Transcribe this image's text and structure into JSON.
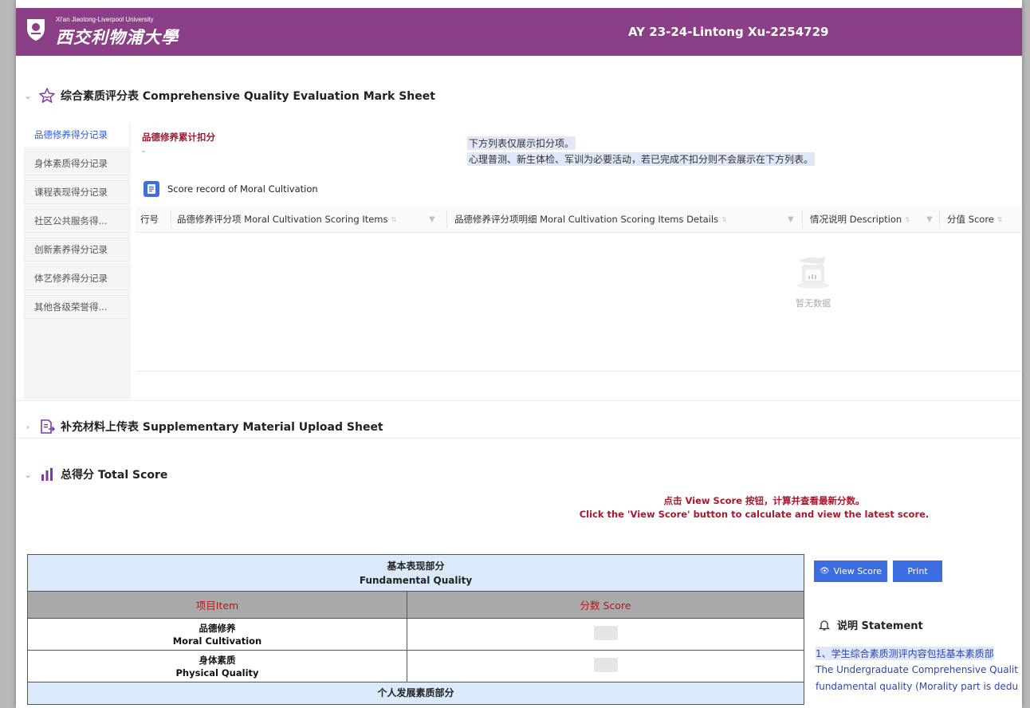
{
  "header": {
    "logo_en": "Xi'an Jiaotong-Liverpool University",
    "logo_cn": "西交利物浦大學",
    "title": "AY 23-24-Lintong Xu-2254729"
  },
  "sections": {
    "evaluation": {
      "title": "综合素质评分表 Comprehensive Quality Evaluation Mark Sheet",
      "expanded": true
    },
    "supplementary": {
      "title": "补充材料上传表 Supplementary Material Upload Sheet",
      "expanded": false
    },
    "total": {
      "title": "总得分 Total Score",
      "expanded": true
    }
  },
  "menu": {
    "items": [
      {
        "label": "品德修养得分记录",
        "active": true
      },
      {
        "label": "身体素质得分记录",
        "active": false
      },
      {
        "label": "课程表现得分记录",
        "active": false
      },
      {
        "label": "社区公共服务得...",
        "active": false
      },
      {
        "label": "创新素养得分记录",
        "active": false
      },
      {
        "label": "体艺修养得分记录",
        "active": false
      },
      {
        "label": "其他各级荣誉得...",
        "active": false
      }
    ]
  },
  "moral": {
    "deduct_label": "品德修养累计扣分",
    "deduct_value": "-",
    "note_line1": "下方列表仅展示扣分项。",
    "note_line2": "心理普测、新生体检、军训为必要活动，若已完成不扣分则不会展示在下方列表。",
    "record_title": "Score record of Moral Cultivation",
    "columns": [
      "行号",
      "品德修养评分项 Moral Cultivation Scoring Items",
      "品德修养评分项明细 Moral Cultivation Scoring Items Details",
      "情况说明 Description",
      "分值 Score"
    ],
    "empty_text": "暂无数据"
  },
  "total": {
    "hint_cn": "点击 View Score 按钮，计算并查看最新分数。",
    "hint_en": "Click the 'View Score' button to calculate and view the latest score.",
    "table": {
      "section1_cn": "基本表现部分",
      "section1_en": "Fundamental Quality",
      "col_item": "项目Item",
      "col_score": "分数 Score",
      "rows": [
        {
          "cn": "品德修养",
          "en": "Moral Cultivation"
        },
        {
          "cn": "身体素质",
          "en": "Physical Quality"
        }
      ],
      "section2_cn": "个人发展素质部分"
    },
    "view_button": "View Score",
    "print_button": "Print",
    "statement_title": "说明 Statement",
    "statement_line1": "1、学生综合素质测评内容包括基本素质部",
    "statement_line2": "The Undergraduate Comprehensive Qualit",
    "statement_line3": "fundamental quality (Morality part is dedu"
  },
  "colors": {
    "header_bg": "#8b3f86",
    "accent_blue": "#3c6de0",
    "hint_red": "#a8182c",
    "table_blue": "#dbeafb"
  },
  "icons": {
    "evaluation": "star-icon",
    "supplementary": "document-upload-icon",
    "total": "bar-chart-icon"
  }
}
